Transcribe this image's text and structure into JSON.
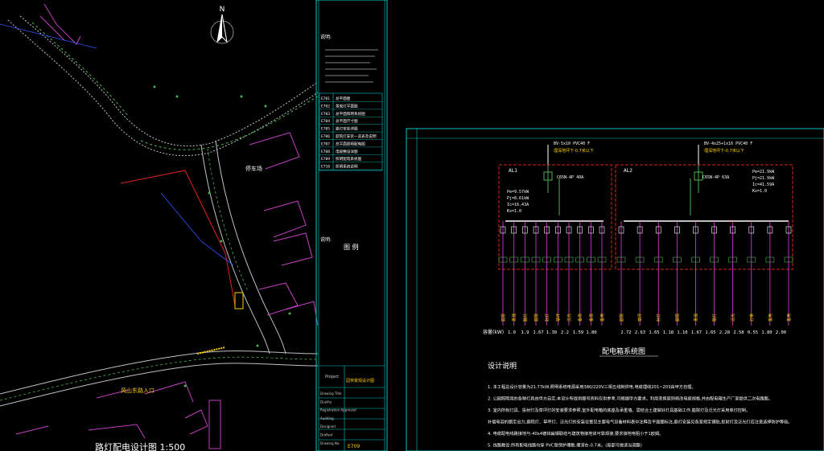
{
  "map": {
    "north_label": "N",
    "label_parking": "停车场",
    "label_entrance": "风山东路入口",
    "drawing_title": "路灯配电设计图 1:500"
  },
  "notes_panel": {
    "heading": "说明:",
    "drawing_list": [
      {
        "code": "E701",
        "name": "总平面图"
      },
      {
        "code": "E702",
        "name": "景观灯平面图"
      },
      {
        "code": "E703",
        "name": "总平面照明系统图"
      },
      {
        "code": "E704",
        "name": "总平面尺寸图"
      },
      {
        "code": "E705",
        "name": "路灯安装详图"
      },
      {
        "code": "E706",
        "name": "庭院灯安装一览表及说明"
      },
      {
        "code": "E707",
        "name": "总平面照明配电图"
      },
      {
        "code": "E708",
        "name": "电缆敷设详图"
      },
      {
        "code": "E709",
        "name": "照明配电系统图"
      },
      {
        "code": "E710",
        "name": "照明系统说明"
      }
    ],
    "legend_title": "图  例",
    "title_block": {
      "project_en": "Project",
      "project_cn": "园林景观设计图",
      "rows": [
        "Drawing Title",
        "Quality",
        "Registration Approved",
        "Auditing",
        "Designed",
        "Drafted",
        "Drawing No."
      ],
      "drawing_no": "E709"
    }
  },
  "schematic": {
    "title": "配电箱系统图",
    "boxes": [
      {
        "id": "AL1",
        "feed": "BV-5x10 PVC40 F",
        "feed_note": "埋深地坪下-0.7米以下",
        "params": [
          "Pe=9.57kW",
          "Pj=8.61kW",
          "Ic=16.43A",
          "Kx=1.0"
        ],
        "breaker": "C65N-4P 40A"
      },
      {
        "id": "AL2",
        "feed": "BV-4x25+1x16 PVC40 F",
        "feed_note": "埋深地坪下-0.7米以下",
        "params": [
          "Pe=21.9kW",
          "Pj=21.9kW",
          "Ic=41.59A",
          "Kx=1.0"
        ],
        "breaker": "C65N-4P 63A"
      }
    ],
    "circuit_labels_al1": [
      "庭院",
      "景观",
      "路灯",
      "庭院",
      "射灯",
      "草坪",
      "泛光",
      "备用",
      "备用",
      "备用"
    ],
    "circuit_labels_al2": [
      "庭院",
      "草坪",
      "射灯",
      "庭院",
      "景观",
      "路灯",
      "泛光",
      "灯带",
      "备用",
      "备用"
    ],
    "capacity_label": "容量(kW)",
    "capacities_al1": [
      "1.0",
      "1.9",
      "1.67",
      "1.30",
      "2.2",
      "1.59",
      "1.80"
    ],
    "capacities_al2": [
      "2.72",
      "2.63",
      "1.65",
      "1.18",
      "1.10",
      "1.67",
      "1.65",
      "2.28",
      "2.58",
      "0.55",
      "1.80",
      "2.00"
    ]
  },
  "design_notes": {
    "title": "设计说明",
    "items": [
      "1. 本工程总设计容量为21.77kW,照明系统电源采用380/220V三相五线制供电,电缆埋线201~203由甲方自理。",
      "2. 公园照明用的各种灯具由甲方自定,本设计所提供图号资料仅供参考,可根据甲方要求。利用变换原则修改电缆规格,并由配电箱生产厂家提供二次电路图。",
      "3. 室内所有灯具、投射灯及草坪灯的安装要求参照,室外配电箱的底座及承重墙。需结合土建做好灯具基础工作,庭院灯及泛光灯采用单灯控制。",
      "   补偿电容的额定出力,庭院灯、草坪灯、泛光灯的安装位置见主要电气设备材料表中注释及平面图标注,庭灯安装见各室规定铺贴,投射灯及泛光灯应注意选择防护等级。",
      "4. 电缆配电线路接地与-40x4镀锌扁钢联结与建筑物接地体可靠焊接,要求接地电阻小于1欧姆。",
      "5. 线路敷设:所有配电线路均穿 PVC管保护埋敷,埋深在-0.7米。(局部可做适当调整)"
    ]
  }
}
